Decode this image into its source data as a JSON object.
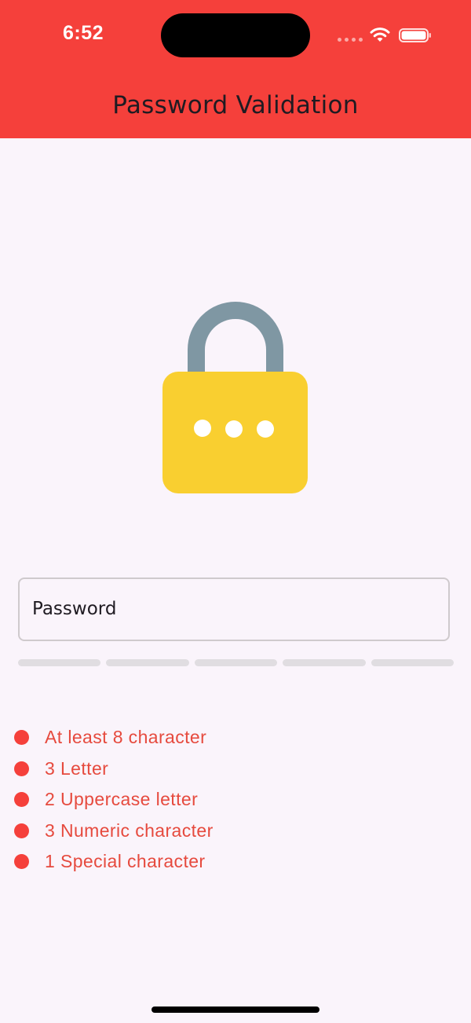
{
  "status_bar": {
    "time": "6:52",
    "icons": [
      "cellular-signal-icon",
      "wifi-icon",
      "battery-icon"
    ]
  },
  "app_bar": {
    "title": "Password Validation",
    "background": "#f5403b"
  },
  "hero": {
    "icon": "padlock-icon",
    "body_color": "#f9cf30",
    "shackle_color": "#7f97a3"
  },
  "password_field": {
    "placeholder": "Password",
    "value": ""
  },
  "strength_meter": {
    "segments": 5,
    "filled": 0
  },
  "requirements": [
    {
      "text": "At least 8 character",
      "met": false
    },
    {
      "text": "3 Letter",
      "met": false
    },
    {
      "text": "2 Uppercase letter",
      "met": false
    },
    {
      "text": "3 Numeric character",
      "met": false
    },
    {
      "text": "1 Special character",
      "met": false
    }
  ],
  "colors": {
    "accent": "#f5403b",
    "unmet_text": "#e64a3e",
    "background": "#faf4fb"
  }
}
